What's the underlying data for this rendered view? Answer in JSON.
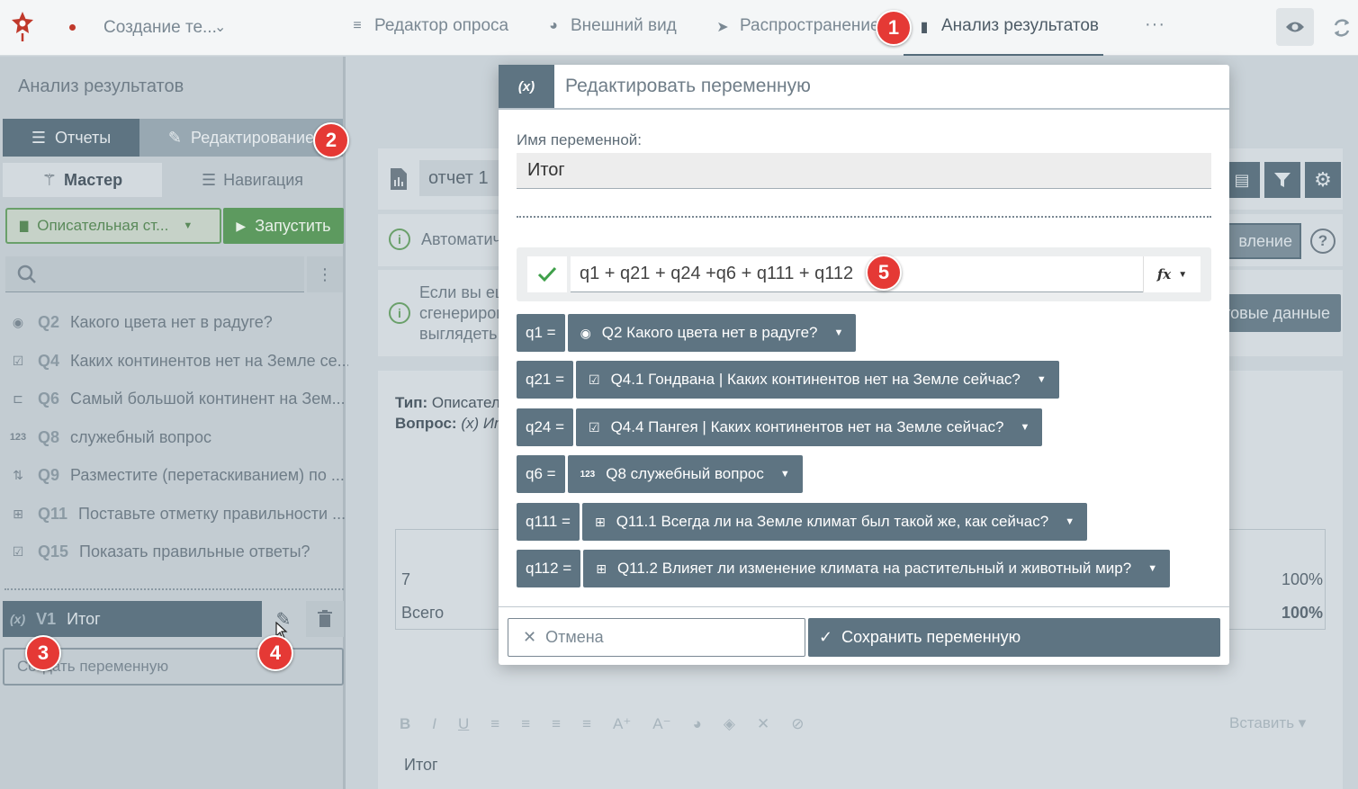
{
  "topbar": {
    "survey_name": "Создание те...",
    "tabs": [
      {
        "label": "Редактор опроса",
        "icon": "edit-list-icon"
      },
      {
        "label": "Внешний вид",
        "icon": "palette-icon"
      },
      {
        "label": "Распространение",
        "icon": "send-icon"
      },
      {
        "label": "Анализ результатов",
        "icon": "bar-chart-icon"
      }
    ],
    "more": "···"
  },
  "badges": [
    "1",
    "2",
    "3",
    "4",
    "5"
  ],
  "sidebar": {
    "title": "Анализ результатов",
    "seg_reports": "Отчеты",
    "seg_edit": "Редактирование",
    "tab_master": "Мастер",
    "tab_nav": "Навигация",
    "select_label": "Описательная ст...",
    "run_label": "Запустить",
    "questions": [
      {
        "num": "Q2",
        "text": "Какого цвета нет в радуге?"
      },
      {
        "num": "Q4",
        "text": "Каких континентов нет на Земле се..."
      },
      {
        "num": "Q6",
        "text": "Самый большой континент на Зем..."
      },
      {
        "num": "Q8",
        "text": "служебный вопрос"
      },
      {
        "num": "Q9",
        "text": "Разместите (перетаскиванием) по ..."
      },
      {
        "num": "Q11",
        "text": "Поставьте отметку правильности ..."
      },
      {
        "num": "Q15",
        "text": "Показать правильные ответы?"
      }
    ],
    "variable": {
      "icon_text": "(x)",
      "num": "V1",
      "name": "Итог"
    },
    "create_var_placeholder": "Создать переменную"
  },
  "main": {
    "report_name": "отчет 1",
    "auto_text": "Автоматич",
    "update_btn": "вление",
    "info_text": [
      "Если вы ещ",
      "сгенериров",
      "выглядеть"
    ],
    "test_btn": "товые данные",
    "type_label": "Тип:",
    "type_value": "Описател",
    "question_label": "Вопрос:",
    "question_value": "(x) Ит",
    "row1_label": "7",
    "row1_pct": "100%",
    "row2_label": "Всего",
    "row2_pct": "100%",
    "insert_label": "Вставить",
    "bottom_text": "Итог"
  },
  "modal": {
    "icon_text": "(x)",
    "title": "Редактировать переменную",
    "name_label": "Имя переменной:",
    "name_value": "Итог",
    "formula": "q1 + q21 + q24 +q6 + q111 + q112",
    "fx_label": "fx",
    "vars": [
      {
        "key": "q1 =",
        "icon": "radio-icon",
        "label": "Q2 Какого цвета нет в радуге?"
      },
      {
        "key": "q21 =",
        "icon": "checkbox-icon",
        "label": "Q4.1 Гондвана | Каких континентов нет на Земле сейчас?"
      },
      {
        "key": "q24 =",
        "icon": "checkbox-icon",
        "label": "Q4.4 Пангея | Каких континентов нет на Земле сейчас?"
      },
      {
        "key": "q6 =",
        "icon": "number-icon",
        "label": "Q8 служебный вопрос"
      },
      {
        "key": "q111 =",
        "icon": "grid-icon",
        "label": "Q11.1 Всегда ли на Земле климат был такой же, как сейчас?"
      },
      {
        "key": "q112 =",
        "icon": "grid-icon",
        "label": "Q11.2 Влияет ли изменение климата на растительный и животный мир?"
      }
    ],
    "cancel": "Отмена",
    "save": "Сохранить переменную"
  },
  "colors": {
    "accent": "#5e7482",
    "green": "#5d9a5f",
    "badge": "#e53935"
  }
}
